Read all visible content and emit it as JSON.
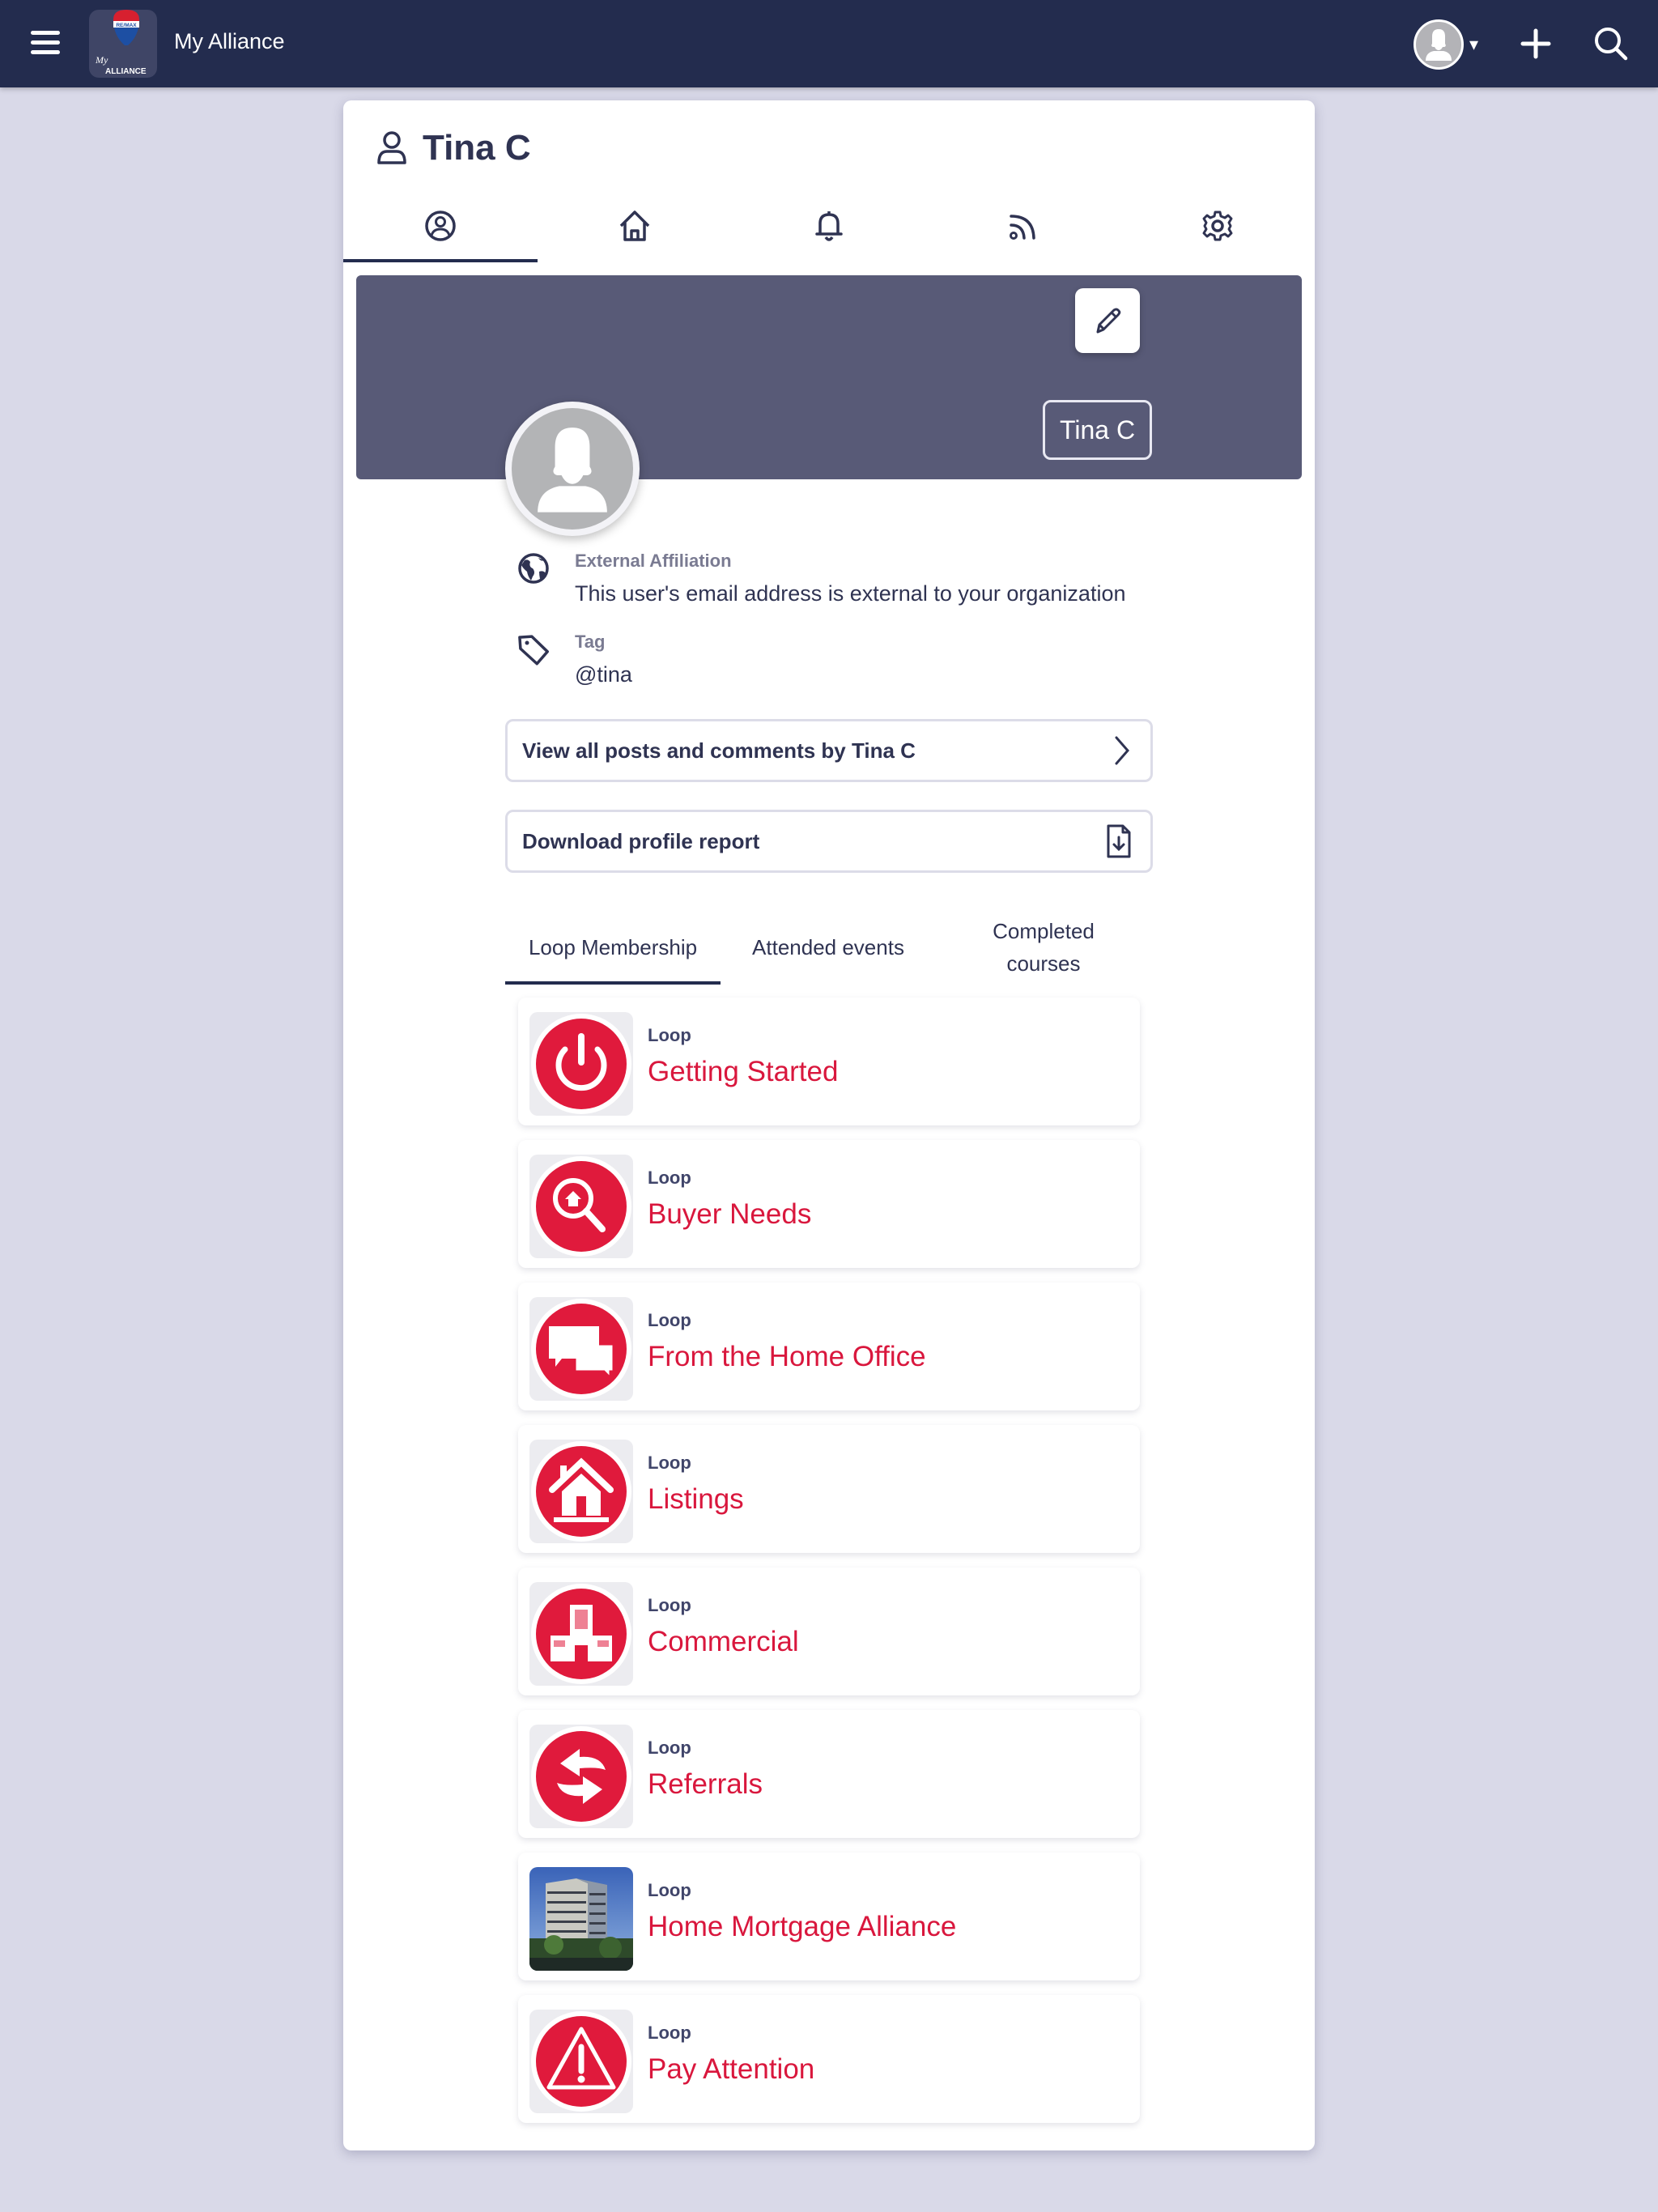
{
  "topbar": {
    "app_title": "My Alliance",
    "logo_text_top": "RE/MAX",
    "logo_text_my": "My",
    "logo_text_alliance": "ALLIANCE",
    "caret": "▾"
  },
  "profile": {
    "name": "Tina C",
    "badge_name": "Tina C",
    "tabs": [
      {
        "id": "profile",
        "icon": "user-circle-icon",
        "active": true
      },
      {
        "id": "home",
        "icon": "home-icon",
        "active": false
      },
      {
        "id": "notifications",
        "icon": "bell-icon",
        "active": false
      },
      {
        "id": "feed",
        "icon": "rss-icon",
        "active": false
      },
      {
        "id": "settings",
        "icon": "gear-icon",
        "active": false
      }
    ],
    "external_affiliation": {
      "label": "External Affiliation",
      "value": "This user's email address is external to your organization"
    },
    "tag": {
      "label": "Tag",
      "value": "@tina"
    },
    "actions": {
      "view_posts": "View all posts and comments by Tina C",
      "download_report": "Download profile report"
    },
    "subtabs": [
      {
        "label": "Loop Membership",
        "active": true
      },
      {
        "label": "Attended events",
        "active": false
      },
      {
        "label": "Completed courses",
        "active": false
      }
    ]
  },
  "colors": {
    "navbar": "#232c4e",
    "cover": "#585a77",
    "accent_red": "#d9173d",
    "page_bg": "#d9d9e8"
  },
  "loops": [
    {
      "type": "Loop",
      "name": "Getting Started",
      "icon": "power-icon"
    },
    {
      "type": "Loop",
      "name": "Buyer Needs",
      "icon": "house-search-icon"
    },
    {
      "type": "Loop",
      "name": "From the Home Office",
      "icon": "chat-bubbles-icon"
    },
    {
      "type": "Loop",
      "name": "Listings",
      "icon": "house-icon"
    },
    {
      "type": "Loop",
      "name": "Commercial",
      "icon": "office-building-icon"
    },
    {
      "type": "Loop",
      "name": "Referrals",
      "icon": "swap-arrows-icon"
    },
    {
      "type": "Loop",
      "name": "Home Mortgage Alliance",
      "icon": "building-photo"
    },
    {
      "type": "Loop",
      "name": "Pay Attention",
      "icon": "warning-icon"
    }
  ]
}
